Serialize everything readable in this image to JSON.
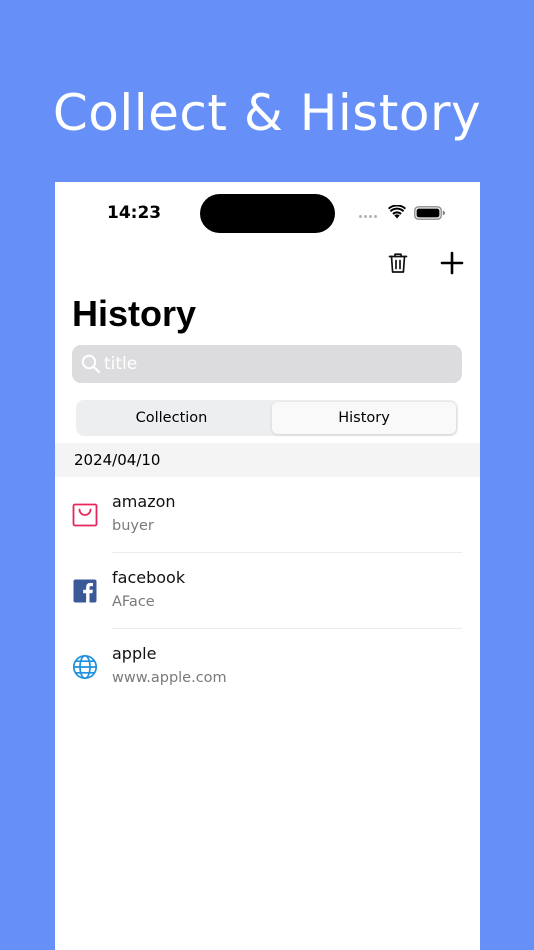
{
  "promo": {
    "title": "Collect & History"
  },
  "status_bar": {
    "time": "14:23"
  },
  "header": {
    "title": "History"
  },
  "search": {
    "placeholder": "title"
  },
  "tabs": [
    {
      "label": "Collection",
      "selected": false
    },
    {
      "label": "History",
      "selected": true
    }
  ],
  "section": {
    "date": "2024/04/10"
  },
  "items": [
    {
      "title": "amazon",
      "subtitle": "buyer",
      "icon": "shopping-bag-icon"
    },
    {
      "title": "facebook",
      "subtitle": "AFace",
      "icon": "facebook-icon"
    },
    {
      "title": "apple",
      "subtitle": "www.apple.com",
      "icon": "globe-icon"
    }
  ],
  "colors": {
    "background": "#6690F7",
    "facebook_blue": "#3B5998",
    "amazon_pink": "#E8265E",
    "globe_blue": "#1E90E0"
  }
}
